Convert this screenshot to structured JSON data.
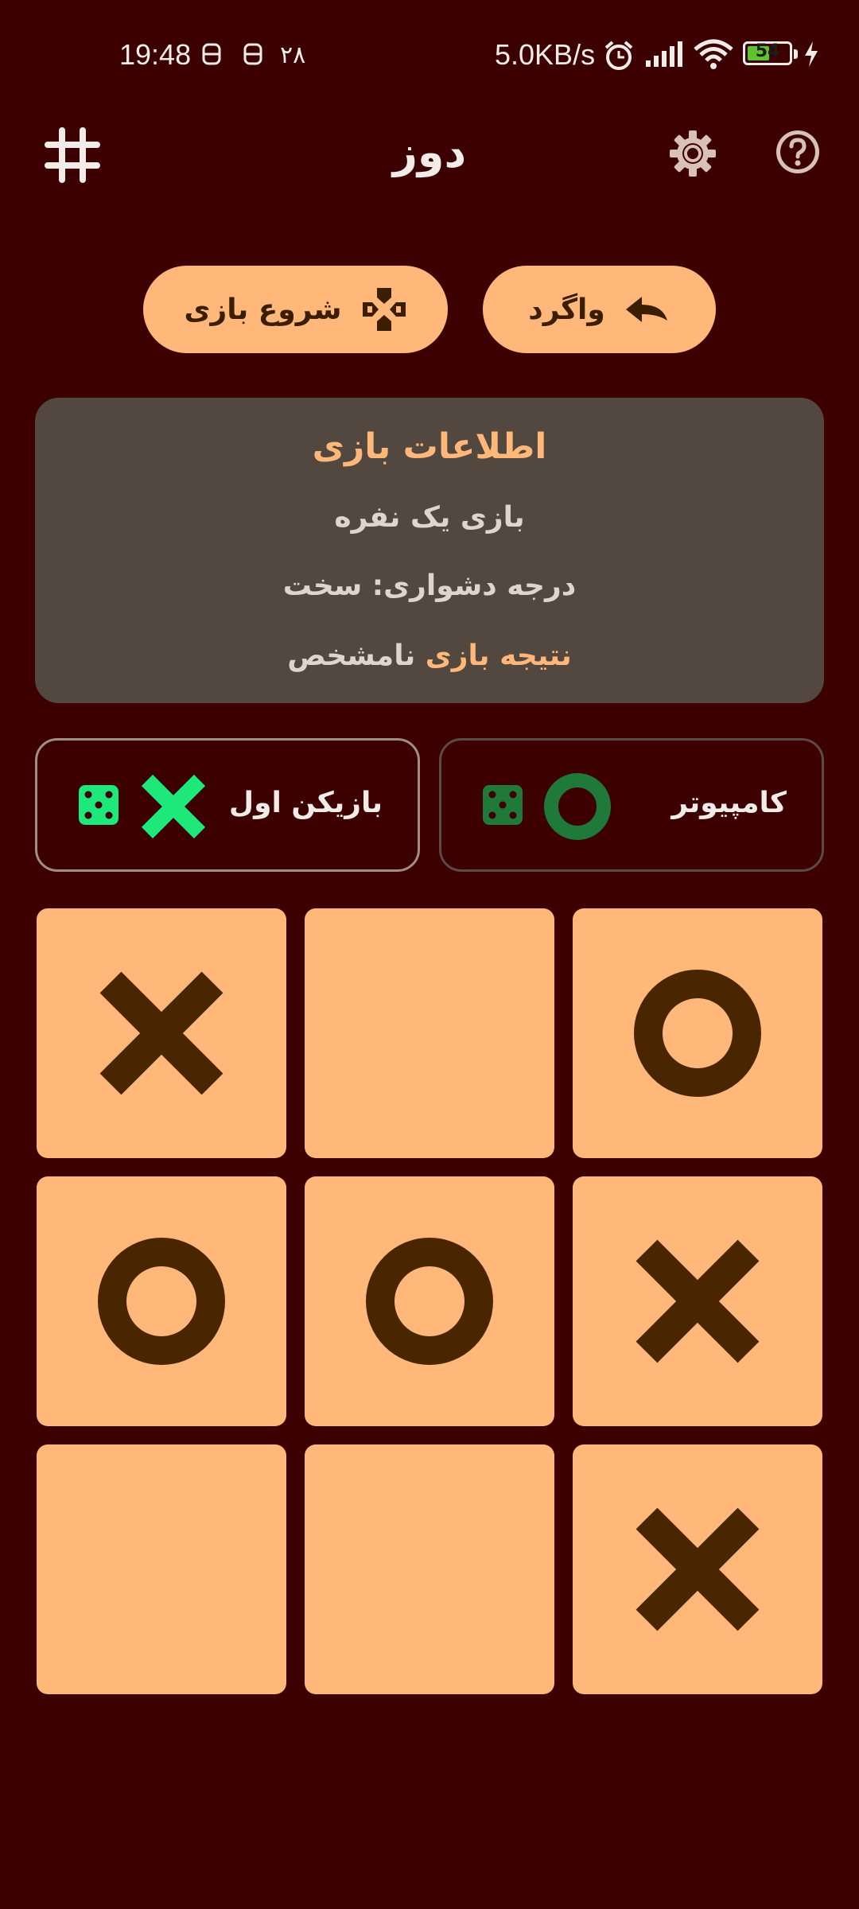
{
  "status_bar": {
    "time": "19:48",
    "notification_count": "۲۸",
    "network_speed": "5.0KB/s",
    "battery_level": "54"
  },
  "app_bar": {
    "title": "دوز",
    "left_icon": "hash-icon",
    "right_icons": [
      "settings-icon",
      "help-icon"
    ]
  },
  "actions": {
    "undo_label": "واگرد",
    "start_label": "شروع بازی"
  },
  "game_info": {
    "title": "اطلاعات بازی",
    "mode": "بازی یک نفره",
    "difficulty": "درجه دشواری: سخت",
    "result_label": "نتیجه بازی",
    "result_value": "نامشخص"
  },
  "players": [
    {
      "name": "کامپیوتر",
      "mark": "O",
      "active": false
    },
    {
      "name": "بازیکن اول",
      "mark": "X",
      "active": true
    }
  ],
  "board": [
    "O",
    "",
    "X",
    "X",
    "O",
    "O",
    "X",
    "",
    ""
  ],
  "colors": {
    "background": "#3d0000",
    "accent": "#ffb87a",
    "mark": "#4a2600",
    "card": "#524840",
    "player_x": "#1ee87a",
    "computer_o": "#1f7a3a"
  }
}
